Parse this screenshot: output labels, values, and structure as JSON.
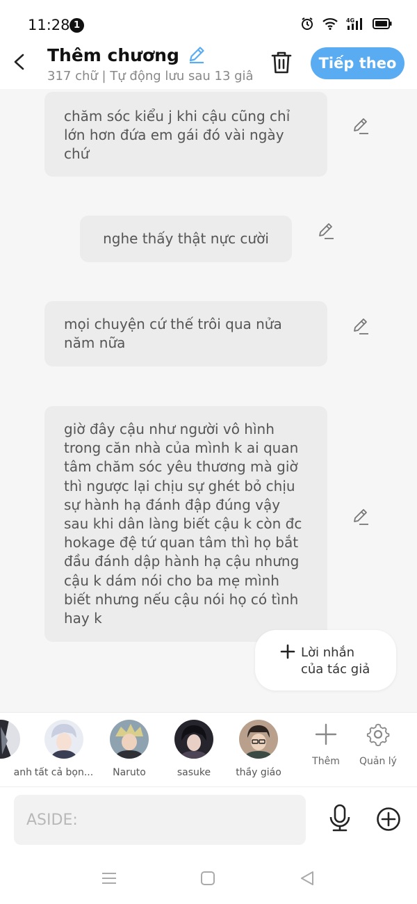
{
  "status_bar": {
    "time": "11:28",
    "notification_count": "1",
    "network": "4G"
  },
  "header": {
    "title": "Thêm chương",
    "subtitle": "317 chữ | Tự động lưu sau 13 giâ",
    "next_label": "Tiếp theo"
  },
  "messages": [
    {
      "text": "chăm sóc kiểu j khi cậu cũng chỉ lớn hơn đứa em gái đó vài ngày chứ"
    },
    {
      "text": "nghe thấy thật nực cười"
    },
    {
      "text": "mọi chuyện cứ thế trôi qua nửa năm nữa"
    },
    {
      "text": "giờ đây cậu như người vô hình trong căn nhà của mình k ai quan tâm chăm sóc yêu thương mà giờ thì ngược lại chịu sự ghét bỏ chịu sự hành hạ đánh đập đúng vậy sau khi dân làng biết cậu k còn đc hokage đệ tứ quan tâm thì họ bắt đầu đánh dập hành hạ cậu nhưng cậu k dám nói cho ba mẹ mình biết nhưng nếu cậu nói  họ có tình hay k"
    }
  ],
  "author_note": {
    "line1": "Lời nhắn",
    "line2": "của tác giả"
  },
  "characters": [
    {
      "name": "anh"
    },
    {
      "name": "tất cả bọn..."
    },
    {
      "name": "Naruto"
    },
    {
      "name": "sasuke"
    },
    {
      "name": "thầy giáo"
    }
  ],
  "tools": {
    "add_label": "Thêm",
    "manage_label": "Quản lý"
  },
  "input": {
    "placeholder": "ASIDE:"
  },
  "colors": {
    "accent": "#5aacf2",
    "bubble": "#ececec",
    "background": "#f6f6f6"
  }
}
